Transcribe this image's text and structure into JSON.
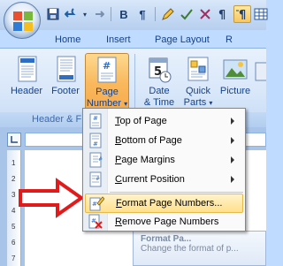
{
  "quick_access": {
    "bold_label": "B",
    "pilcrow_label": "¶"
  },
  "tabs": [
    {
      "label": "Home"
    },
    {
      "label": "Insert"
    },
    {
      "label": "Page Layout"
    },
    {
      "label": "R"
    }
  ],
  "ribbon": {
    "header_label": "Header",
    "footer_label": "Footer",
    "page_number_line1": "Page",
    "page_number_line2": "Number",
    "date_time_line1": "Date",
    "date_time_line2": "& Time",
    "quick_parts_line1": "Quick",
    "quick_parts_line2": "Parts",
    "picture_label": "Picture",
    "group_label": "Header & F",
    "calendar_number": "5"
  },
  "ruler": {
    "marks": [
      "1",
      "2",
      "3",
      "4",
      "5",
      "6",
      "7"
    ]
  },
  "menu": {
    "items": [
      {
        "label": "Top of Page",
        "accel": "T",
        "rest": "op of Page",
        "icon": "page-top-icon",
        "submenu": true
      },
      {
        "label": "Bottom of Page",
        "accel": "B",
        "rest": "ottom of Page",
        "icon": "page-bottom-icon",
        "submenu": true
      },
      {
        "label": "Page Margins",
        "accel": "P",
        "rest": "age Margins",
        "icon": "page-margins-icon",
        "submenu": true
      },
      {
        "label": "Current Position",
        "accel": "C",
        "rest": "urrent Position",
        "icon": "current-position-icon",
        "submenu": true
      },
      {
        "label": "Format Page Numbers...",
        "accel": "F",
        "rest": "ormat Page Numbers...",
        "icon": "format-page-numbers-icon",
        "submenu": false,
        "highlighted": true
      },
      {
        "label": "Remove Page Numbers",
        "accel": "R",
        "rest": "emove Page Numbers",
        "icon": "remove-page-numbers-icon",
        "submenu": false
      }
    ]
  },
  "tooltip": {
    "line1": "Format Pa...",
    "line2": "Change the format of p..."
  },
  "colors": {
    "accent_orange": "#f9b85c",
    "arrow_red": "#e11b1b",
    "ribbon_blue": "#15428b"
  }
}
